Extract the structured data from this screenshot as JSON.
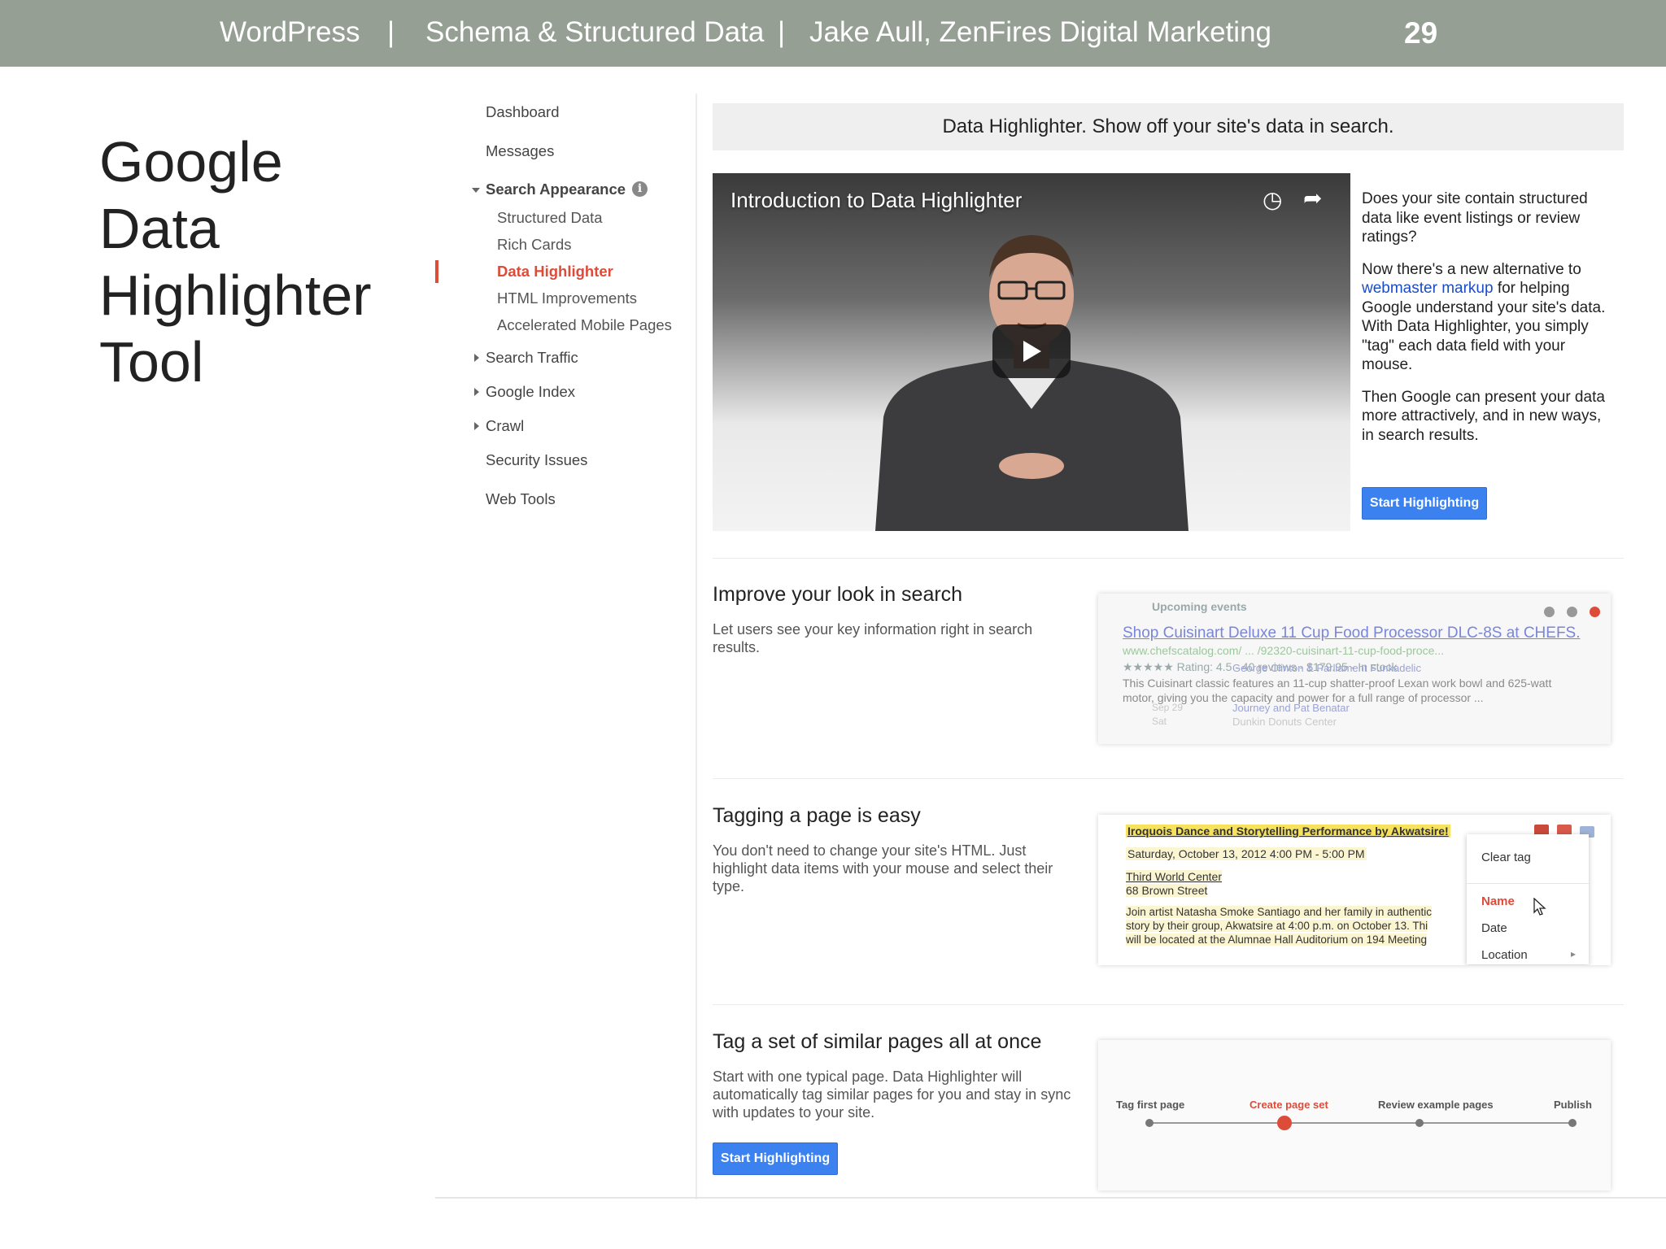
{
  "header": {
    "platform": "WordPress",
    "sep": "|",
    "topic": "Schema & Structured Data",
    "author": "Jake Aull, ZenFires Digital Marketing",
    "page_number": "29"
  },
  "slide_title_lines": [
    "Google",
    "Data",
    "Highlighter",
    "Tool"
  ],
  "sidebar": {
    "dashboard": "Dashboard",
    "messages": "Messages",
    "search_appearance": "Search Appearance",
    "structured_data": "Structured Data",
    "rich_cards": "Rich Cards",
    "data_highlighter": "Data Highlighter",
    "html_improvements": "HTML Improvements",
    "amp": "Accelerated Mobile Pages",
    "search_traffic": "Search Traffic",
    "google_index": "Google Index",
    "crawl": "Crawl",
    "security_issues": "Security Issues",
    "web_tools": "Web Tools"
  },
  "main": {
    "banner": "Data Highlighter. Show off your site's data in search.",
    "video_title": "Introduction to Data Highlighter",
    "desc_p1": "Does your site contain structured data like event listings or review ratings?",
    "desc_p2_pre": "Now there's a new alternative to ",
    "desc_p2_link": "webmaster markup",
    "desc_p2_post": " for helping Google understand your site's data. With Data Highlighter, you simply \"tag\" each data field with your mouse.",
    "desc_p3": "Then Google can present your data more attractively, and in new ways, in search results.",
    "start_button": "Start Highlighting",
    "section1": {
      "title": "Improve your look in search",
      "text": "Let users see your key information right in search results.",
      "upcoming": "Upcoming events",
      "shop_link": "Shop Cuisinart Deluxe 11 Cup Food Processor DLC-8S at CHEFS.",
      "url": "www.chefscatalog.com/ ... /92320-cuisinart-11-cup-food-proce...",
      "rating": "★★★★★ Rating: 4.5 - 40 reviews - $179.95 - In stock",
      "snippet1": "This Cuisinart classic features an 11-cup shatter-proof Lexan work bowl and 625-watt",
      "snippet2": "motor, giving you the capacity and power for a full range of processor ...",
      "event1": "George Clinton & Parliament Funkadelic",
      "event2": "Journey and Pat Benatar",
      "venue": "Dunkin Donuts Center",
      "date_sat": "Sat",
      "date_sep29": "Sep 29"
    },
    "section2": {
      "title": "Tagging a page is easy",
      "text": "You don't need to change your site's HTML. Just highlight data items with your mouse and select their type.",
      "event_title": "Iroquois Dance and Storytelling Performance by Akwatsire!",
      "event_date": "Saturday, October 13, 2012 4:00 PM - 5:00 PM",
      "venue_name": "Third World Center",
      "venue_street": "68 Brown Street",
      "body1": "Join artist Natasha Smoke Santiago and her family in authentic",
      "body2": "story by their group, Akwatsire at 4:00 p.m. on October 13. Thi",
      "body3": "will be located at the Alumnae Hall Auditorium on 194 Meeting",
      "menu_clear": "Clear tag",
      "menu_name": "Name",
      "menu_date": "Date",
      "menu_location": "Location",
      "menu_arrow": "▸"
    },
    "section3": {
      "title": "Tag a set of similar pages all at once",
      "text": "Start with one typical page. Data Highlighter will automatically tag similar pages for you and stay in sync with updates to your site.",
      "steps": [
        "Tag first page",
        "Create page set",
        "Review example pages",
        "Publish"
      ]
    }
  },
  "colors": {
    "header_bg": "#959f94",
    "active": "#dd4b39",
    "button": "#3b82f0",
    "link": "#1a4cc7"
  }
}
